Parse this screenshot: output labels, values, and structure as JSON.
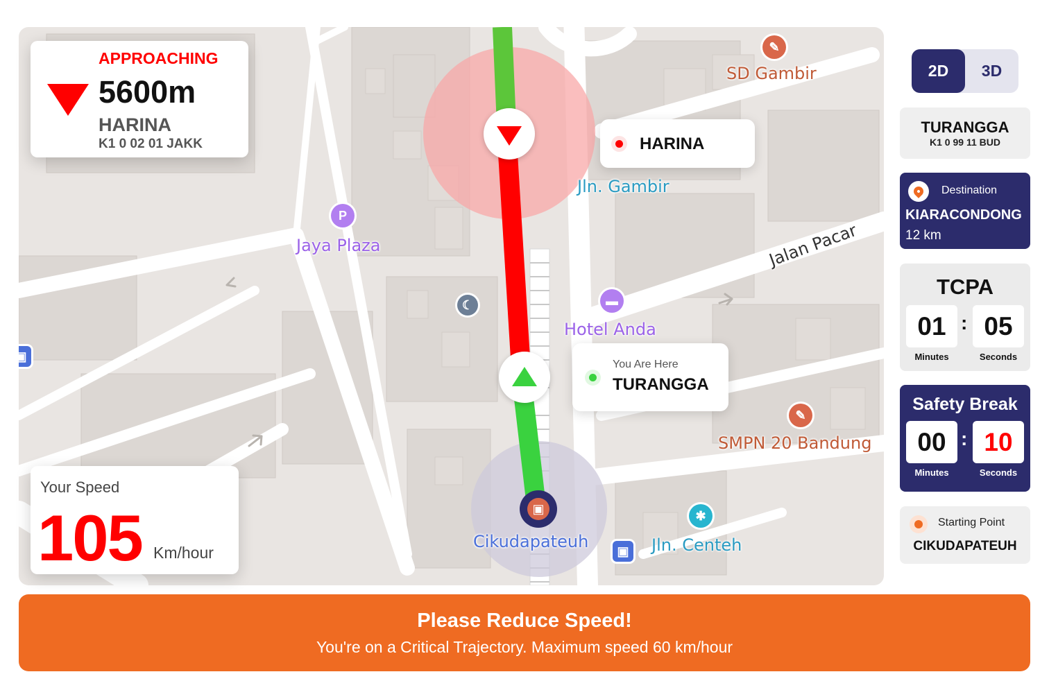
{
  "approaching": {
    "status": "APPROACHING",
    "distance": "5600m",
    "train_name": "HARINA",
    "train_code": "K1 0 02 01 JAKK"
  },
  "speed": {
    "label": "Your Speed",
    "value": "105",
    "unit": "Km/hour"
  },
  "map": {
    "labels": {
      "sd_gambir": "SD Gambir",
      "jln_gambir": "Jln. Gambir",
      "jaya_plaza": "Jaya Plaza",
      "jalan_pacar": "Jalan Pacar",
      "hotel_anda": "Hotel Anda",
      "smpn_20": "SMPN 20 Bandung",
      "cikudapateuh": "Cikudapateuh",
      "jln_centeh": "Jln. Centeh",
      "parking_letter": "P"
    },
    "harina_marker": {
      "name": "HARINA"
    },
    "you_are_here": {
      "caption": "You Are Here",
      "name": "TURANGGA"
    }
  },
  "view_toggle": {
    "option_2d": "2D",
    "option_3d": "3D",
    "selected": "2D"
  },
  "train_info": {
    "name": "TURANGGA",
    "code": "K1 0 99 11 BUD"
  },
  "destination": {
    "label": "Destination",
    "name": "KIARACONDONG",
    "distance": "12 km"
  },
  "tcpa": {
    "title": "TCPA",
    "minutes": "01",
    "seconds": "05",
    "minutes_label": "Minutes",
    "seconds_label": "Seconds"
  },
  "safety_break": {
    "title": "Safety Break",
    "minutes": "00",
    "seconds": "10",
    "minutes_label": "Minutes",
    "seconds_label": "Seconds"
  },
  "starting_point": {
    "label": "Starting Point",
    "name": "CIKUDAPATEUH"
  },
  "alert": {
    "title": "Please Reduce Speed!",
    "message": "You're on a Critical Trajectory. Maximum speed 60 km/hour"
  },
  "colors": {
    "danger": "#ff0000",
    "safe": "#3ad23f",
    "navy": "#2c2c6c",
    "orange": "#ef6b22",
    "map_bg": "#e9e5e2"
  },
  "icons": {
    "approach": "triangle-down-icon",
    "you": "triangle-up-icon",
    "station": "train-icon",
    "destination": "location-pin-icon"
  }
}
